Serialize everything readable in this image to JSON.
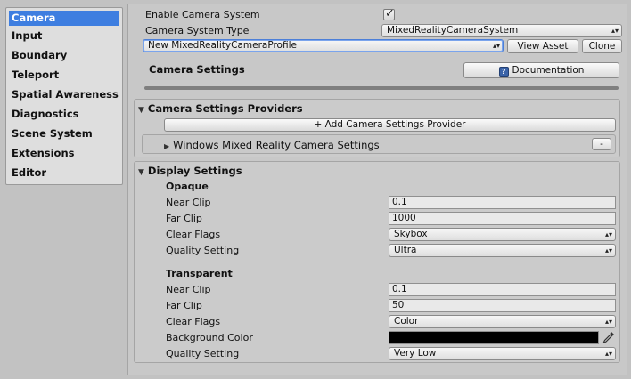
{
  "sidebar": {
    "items": [
      {
        "label": "Camera"
      },
      {
        "label": "Input"
      },
      {
        "label": "Boundary"
      },
      {
        "label": "Teleport"
      },
      {
        "label": "Spatial Awareness"
      },
      {
        "label": "Diagnostics"
      },
      {
        "label": "Scene System"
      },
      {
        "label": "Extensions"
      },
      {
        "label": "Editor"
      }
    ],
    "active_index": 0
  },
  "header": {
    "enable_label": "Enable Camera System",
    "enable_checked": true,
    "system_type_label": "Camera System Type",
    "system_type_value": "MixedRealityCameraSystem",
    "profile_value": "New MixedRealityCameraProfile",
    "view_asset_label": "View Asset",
    "clone_label": "Clone",
    "settings_title": "Camera Settings",
    "documentation_label": "Documentation",
    "doc_icon": "help-book-icon"
  },
  "providers": {
    "title": "Camera Settings Providers",
    "add_label": "+ Add Camera Settings Provider",
    "items": [
      {
        "label": "Windows Mixed Reality Camera Settings",
        "remove_label": "-"
      }
    ]
  },
  "display": {
    "title": "Display Settings",
    "opaque": {
      "heading": "Opaque",
      "near_clip_label": "Near Clip",
      "near_clip_value": "0.1",
      "far_clip_label": "Far Clip",
      "far_clip_value": "1000",
      "clear_flags_label": "Clear Flags",
      "clear_flags_value": "Skybox",
      "quality_label": "Quality Setting",
      "quality_value": "Ultra"
    },
    "transparent": {
      "heading": "Transparent",
      "near_clip_label": "Near Clip",
      "near_clip_value": "0.1",
      "far_clip_label": "Far Clip",
      "far_clip_value": "50",
      "clear_flags_label": "Clear Flags",
      "clear_flags_value": "Color",
      "background_color_label": "Background Color",
      "background_color_value": "#000000",
      "quality_label": "Quality Setting",
      "quality_value": "Very Low"
    }
  },
  "colors": {
    "accent": "#3e7ee0",
    "panel": "#c8c8c8",
    "sidebar": "#dedede"
  }
}
